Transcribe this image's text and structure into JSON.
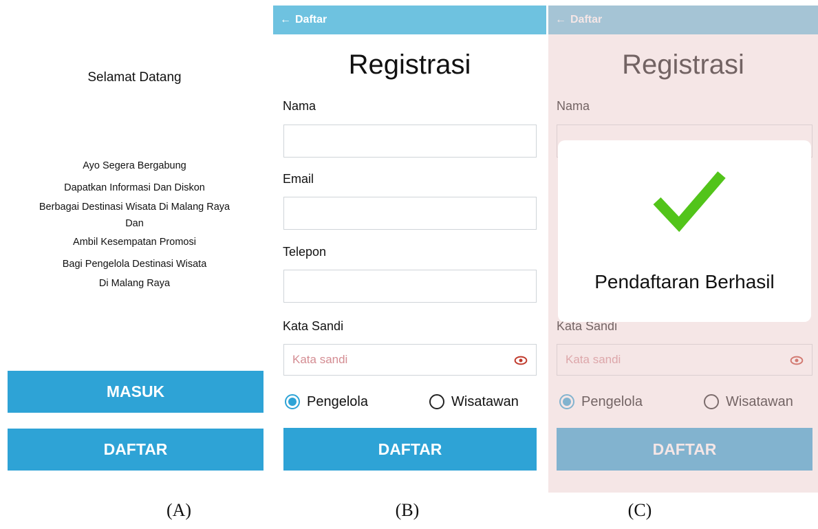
{
  "panel_a": {
    "welcome_title": "Selamat Datang",
    "lines": [
      "Ayo Segera Bergabung",
      "Dapatkan Informasi Dan Diskon",
      "Berbagai Destinasi Wisata Di Malang Raya",
      "Dan",
      "Ambil Kesempatan Promosi",
      "Bagi Pengelola Destinasi Wisata",
      "Di Malang Raya"
    ],
    "masuk_label": "MASUK",
    "daftar_label": "DAFTAR",
    "caption": "(A)"
  },
  "panel_b": {
    "topbar_title": "Daftar",
    "back_icon": "←",
    "form_title": "Registrasi",
    "nama_label": "Nama",
    "email_label": "Email",
    "telepon_label": "Telepon",
    "kata_sandi_label": "Kata Sandi",
    "kata_sandi_placeholder": "Kata sandi",
    "radio_pengelola": "Pengelola",
    "radio_wisatawan": "Wisatawan",
    "submit_label": "DAFTAR",
    "caption": "(B)"
  },
  "panel_c": {
    "topbar_title": "Daftar",
    "back_icon": "←",
    "form_title": "Registrasi",
    "nama_label": "Nama",
    "kata_sandi_label": "Kata Sandi",
    "kata_sandi_placeholder": "Kata sandi",
    "radio_pengelola": "Pengelola",
    "radio_wisatawan": "Wisatawan",
    "submit_label": "DAFTAR",
    "success_message": "Pendaftaran Berhasil",
    "caption": "(C)"
  },
  "colors": {
    "primary_button": "#2ea3d6",
    "topbar": "#6ec2e0",
    "success_check": "#52c41a",
    "eye_icon": "#c0392b"
  },
  "icons": {
    "back": "arrow-left-icon",
    "password_visibility": "eye-icon",
    "success": "checkmark-icon"
  }
}
